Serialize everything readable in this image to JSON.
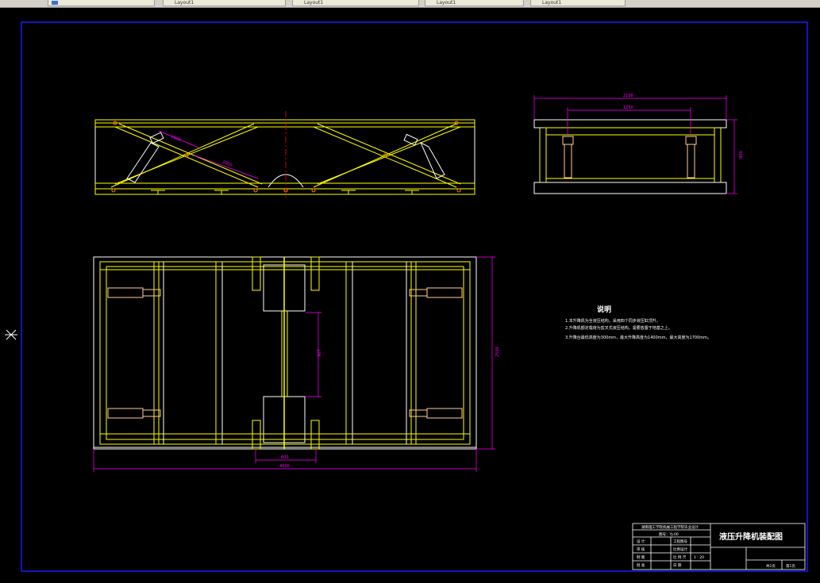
{
  "window": {
    "tabs": [
      {
        "label": ""
      },
      {
        "label": "Layout1"
      },
      {
        "label": "Layout1"
      },
      {
        "label": "Layout1"
      },
      {
        "label": "Layout1"
      }
    ]
  },
  "drawing": {
    "notes": {
      "title": "说明",
      "lines": [
        "1.本升降机为全液压结构，采用四个同步液压缸顶升。",
        "2.升降机额定载荷为剪叉式液压结构，需要放置于地基之上。",
        "3.升降台最低高度为300mm，最大升降高度为1400mm，最大高度为1700mm。"
      ]
    },
    "dimensions": {
      "front_link_1": "1600",
      "front_link_2": "2000",
      "side_top_width": "2100",
      "side_inner_width": "1250",
      "side_height": "800",
      "plan_width": "2500",
      "plan_center_gap": "907",
      "plan_center_width": "600",
      "plan_length": "4000"
    },
    "title_block": {
      "university": "湖南理工学院机械工程学院毕业设计",
      "drawing_no": "图号：YJ-00",
      "title": "液压升降机装配图",
      "rows": [
        [
          "设 计",
          "",
          "工程图号"
        ],
        [
          "审 核",
          "",
          "比例设计"
        ],
        [
          "制 图",
          "",
          "比 例 尺",
          "1 : 20"
        ],
        [
          "批 准",
          "",
          "日 期"
        ]
      ],
      "sheet_total": "共1页",
      "sheet_no": "第1页"
    }
  },
  "colors": {
    "background": "#000000",
    "frame": "#1a1aff",
    "structure": "#ffff00",
    "outline": "#ffffff",
    "dimension": "#ff00ff",
    "centerline": "#ff0000",
    "hydraulic": "#ffcc99"
  }
}
